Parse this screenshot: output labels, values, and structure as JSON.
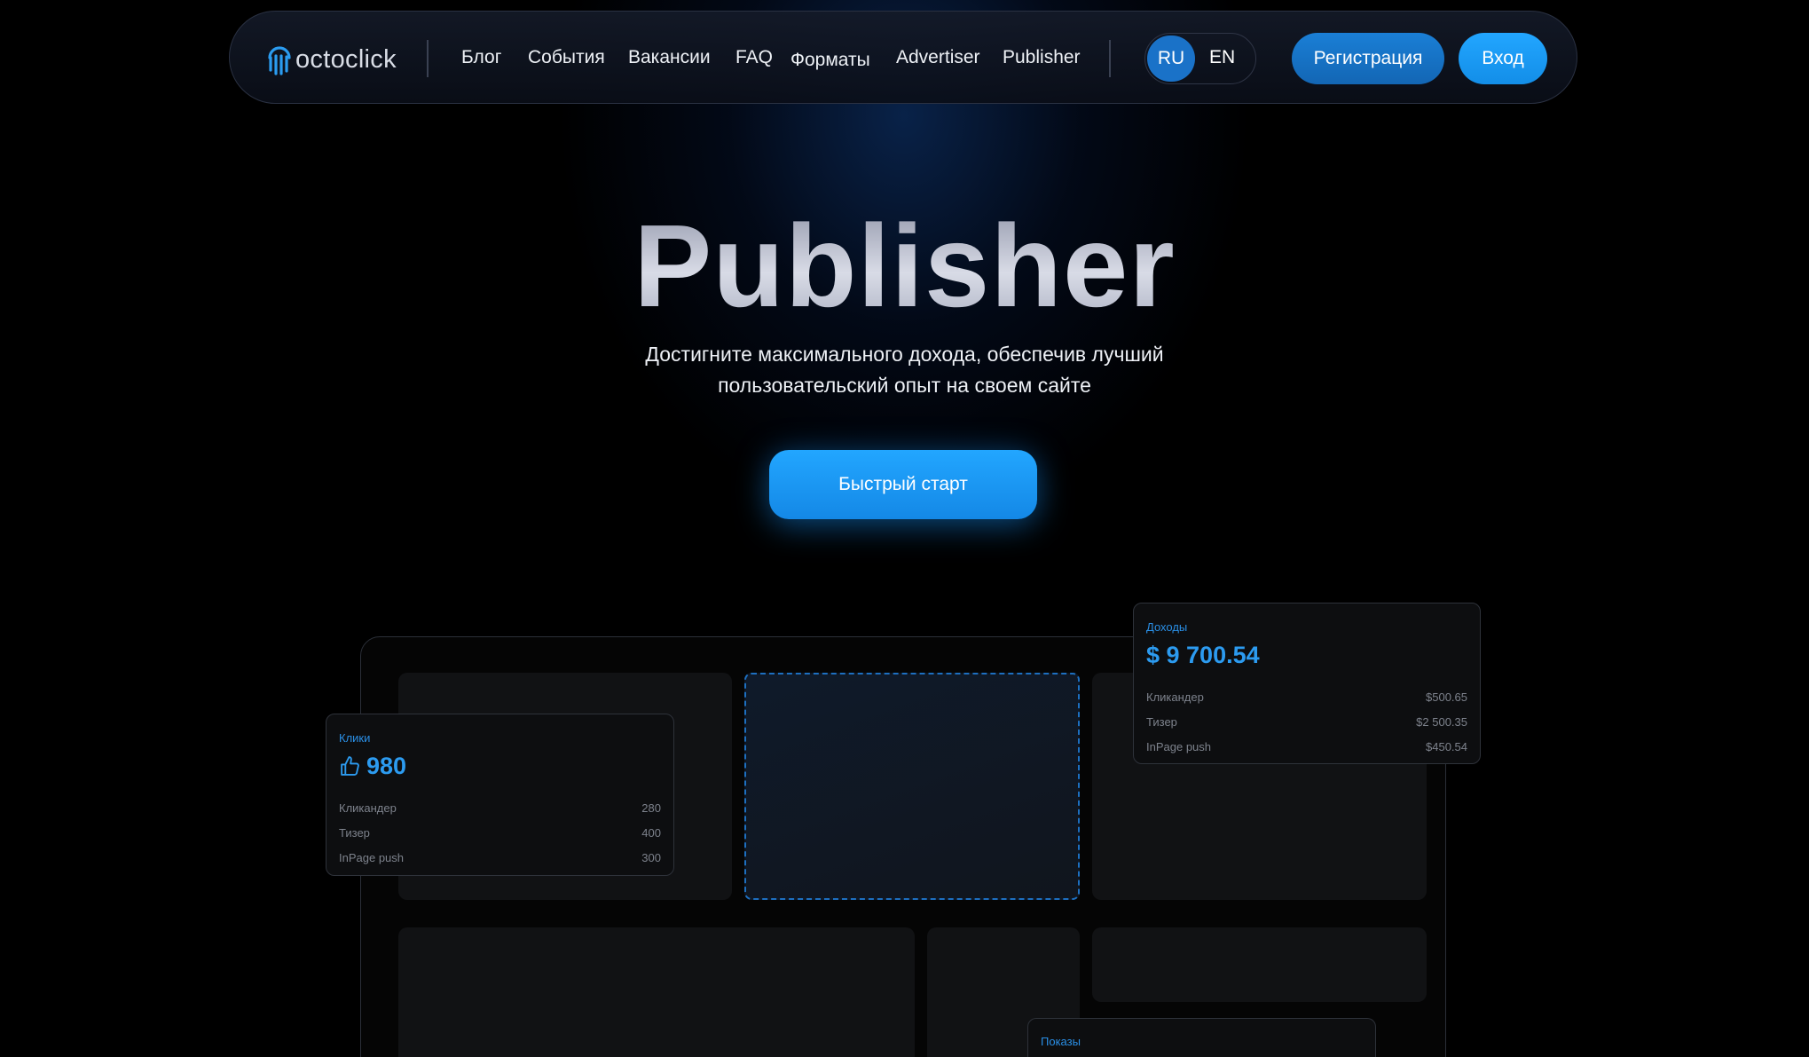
{
  "brand": {
    "name": "octoclick",
    "accent": "#22a6ff"
  },
  "nav": {
    "links": [
      "Блог",
      "События",
      "Вакансии",
      "FAQ",
      "Форматы",
      "Advertiser",
      "Publisher"
    ],
    "languages": {
      "active": "RU",
      "other": "EN"
    },
    "register_label": "Регистрация",
    "login_label": "Вход"
  },
  "hero": {
    "title": "Publisher",
    "subtitle_line1": "Достигните максимального дохода, обеспечив лучший",
    "subtitle_line2": "пользовательский опыт на своем сайте",
    "cta_label": "Быстрый старт"
  },
  "cards": {
    "income": {
      "label": "Доходы",
      "value": "$ 9 700.54",
      "rows": [
        {
          "name": "Кликандер",
          "value": "$500.65"
        },
        {
          "name": "Тизер",
          "value": "$2 500.35"
        },
        {
          "name": "InPage push",
          "value": "$450.54"
        }
      ]
    },
    "clicks": {
      "label": "Клики",
      "value": "980",
      "rows": [
        {
          "name": "Кликандер",
          "value": "280"
        },
        {
          "name": "Тизер",
          "value": "400"
        },
        {
          "name": "InPage push",
          "value": "300"
        }
      ]
    },
    "impressions": {
      "label": "Показы"
    }
  }
}
